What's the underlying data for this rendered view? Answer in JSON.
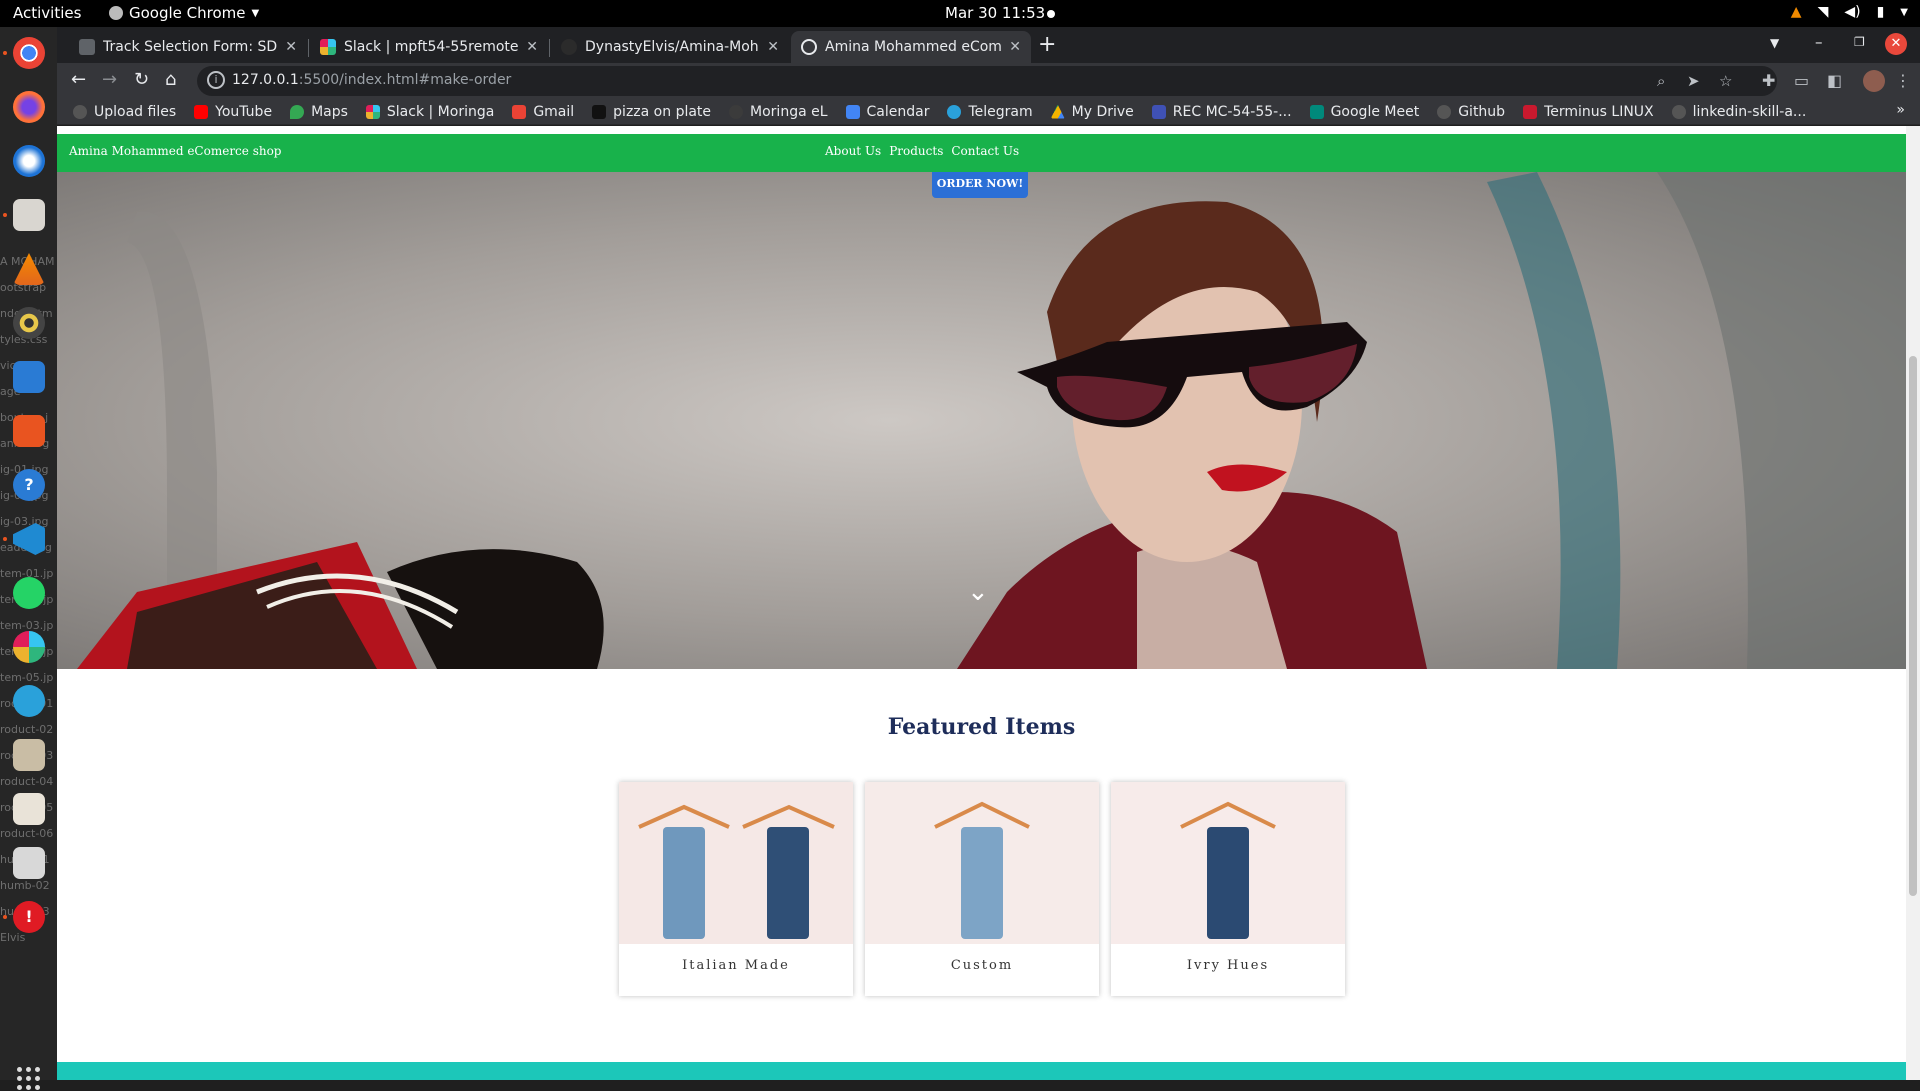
{
  "system": {
    "activities": "Activities",
    "app_name": "Google Chrome",
    "clock": "Mar 30  11:53"
  },
  "browser": {
    "tabs": [
      {
        "label": "Track Selection Form: SD",
        "active": false
      },
      {
        "label": "Slack | mpft54-55remote",
        "active": false
      },
      {
        "label": "DynastyElvis/Amina-Moh",
        "active": false
      },
      {
        "label": "Amina Mohammed eCom",
        "active": true
      }
    ],
    "url_host": "127.0.0.1",
    "url_rest": ":5500/index.html#make-order",
    "bookmarks": [
      "Upload files",
      "YouTube",
      "Maps",
      "Slack | Moringa",
      "Gmail",
      "pizza on plate",
      "Moringa eL",
      "Calendar",
      "Telegram",
      "My Drive",
      "REC MC-54-55-...",
      "Google Meet",
      "Github",
      "Terminus LINUX",
      "linkedin-skill-a..."
    ]
  },
  "dock_bg_text": [
    "A MOHAM",
    "ootstrap",
    "ndex.htm",
    "tyles.css",
    "vic",
    "age",
    "bout-us.j",
    "anner-bg",
    "ig-01.jpg",
    "ig-02.jpg",
    "ig-03.jpg",
    "eader-log",
    "tem-01.jp",
    "tem-02.jp",
    "tem-03.jp",
    "tem-04.jp",
    "tem-05.jp",
    "roduct-01",
    "roduct-02",
    "roduct-03",
    "roduct-04",
    "roduct-05",
    "roduct-06",
    "humb-01",
    "humb-02",
    "humb-03",
    "Elvis"
  ],
  "site": {
    "brand": "Amina Mohammed eComerce shop",
    "nav": [
      "About Us",
      "Products",
      "Contact Us"
    ],
    "order_button": "ORDER NOW!",
    "featured_title": "Featured Items",
    "items": [
      "Italian Made",
      "Custom",
      "Ivry Hues"
    ]
  },
  "colors": {
    "nav_green": "#18b24b",
    "order_blue": "#2b6fd6",
    "title_navy": "#1e2d5a",
    "footer_teal": "#1cc7b9"
  }
}
